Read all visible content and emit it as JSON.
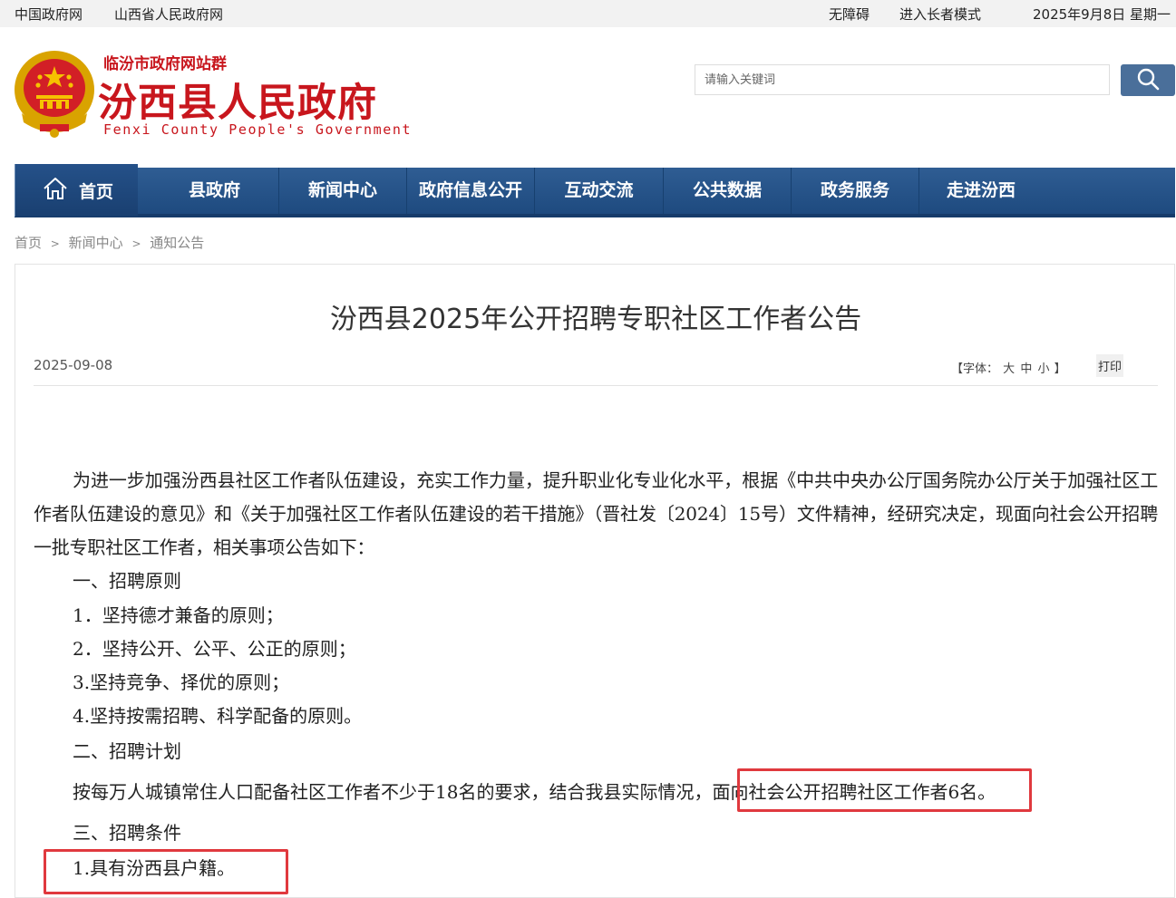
{
  "topbar": {
    "link1": "中国政府网",
    "link2": "山西省人民政府网",
    "accessibility": "无障碍",
    "elder_mode": "进入长者模式",
    "date": "2025年9月8日 星期一"
  },
  "header": {
    "group_name": "临汾市政府网站群",
    "site_name": "汾西县人民政府",
    "site_name_en": "Fenxi County People's Government",
    "search_placeholder": "请输入关键词"
  },
  "nav": {
    "home": "首页",
    "items": [
      "县政府",
      "新闻中心",
      "政府信息公开",
      "互动交流",
      "公共数据",
      "政务服务",
      "走进汾西"
    ]
  },
  "breadcrumb": [
    "首页",
    "新闻中心",
    "通知公告"
  ],
  "breadcrumb_sep": ">",
  "article": {
    "title": "汾西县2025年公开招聘专职社区工作者公告",
    "date": "2025-09-08",
    "font_label": "【字体：",
    "font_large": "大",
    "font_medium": "中",
    "font_small": "小",
    "font_close": "】",
    "print": "打印",
    "intro": "为进一步加强汾西县社区工作者队伍建设，充实工作力量，提升职业化专业化水平，根据《中共中央办公厅国务院办公厅关于加强社区工作者队伍建设的意见》和《关于加强社区工作者队伍建设的若干措施》（晋社发〔2024〕15号）文件精神，经研究决定，现面向社会公开招聘一批专职社区工作者，相关事项公告如下：",
    "section1": "一、招聘原则",
    "principles": [
      "1．坚持德才兼备的原则；",
      "2．坚持公开、公平、公正的原则；",
      "3.坚持竞争、择优的原则；",
      "4.坚持按需招聘、科学配备的原则。"
    ],
    "section2": "二、招聘计划",
    "plan_text": "按每万人城镇常住人口配备社区工作者不少于18名的要求，结合我县实际情况，",
    "plan_highlight": "面向社会公开招聘社区工作者6名。",
    "section3": "三、招聘条件",
    "condition1": "1.具有汾西县户籍。"
  },
  "colors": {
    "brand_red": "#c8161d",
    "nav_blue": "#1e4a7f",
    "highlight_red": "#e0393e"
  }
}
